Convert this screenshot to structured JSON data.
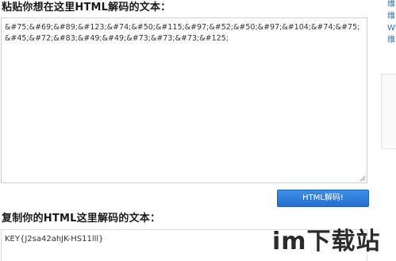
{
  "paste_label": "粘贴你想在这里HTML解码的文本：",
  "encoded_input": "&#75;&#69;&#89;&#123;&#74;&#50;&#115;&#97;&#52;&#50;&#97;&#104;&#74;&#75;&#45;&#72;&#83;&#49;&#49;&#73;&#73;&#73;&#125;",
  "decode_button": "HTML解码!",
  "copy_label": "复制你的HTML这里解码的文本：",
  "decoded_output": "KEY{J2sa42ahJK-HS11lll}",
  "right_links": [
    "维",
    "维",
    "WS",
    "维"
  ],
  "watermark": "im下载站",
  "colors": {
    "button_blue": "#2470d0",
    "link_blue": "#2a6fc0"
  }
}
